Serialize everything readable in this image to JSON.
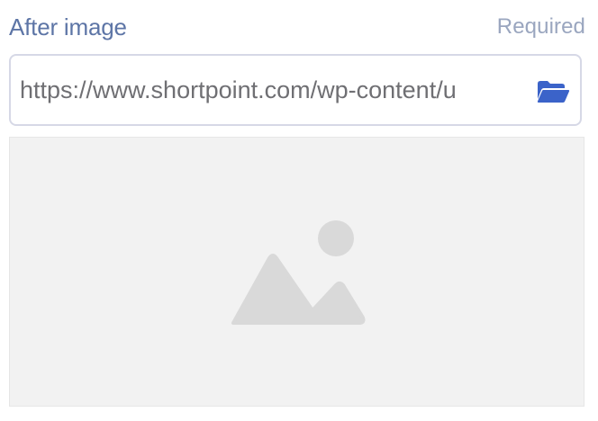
{
  "field": {
    "label": "After image",
    "required_text": "Required"
  },
  "url_input": {
    "value": "https://www.shortpoint.com/wp-content/u"
  },
  "icons": {
    "browse": "folder-open-icon",
    "preview_placeholder": "image-placeholder-icon"
  },
  "colors": {
    "label": "#5d75a6",
    "required": "#9aa6bf",
    "folder_icon": "#3b63c9",
    "preview_bg": "#f2f2f2",
    "placeholder_shape": "#d9d9d9"
  }
}
